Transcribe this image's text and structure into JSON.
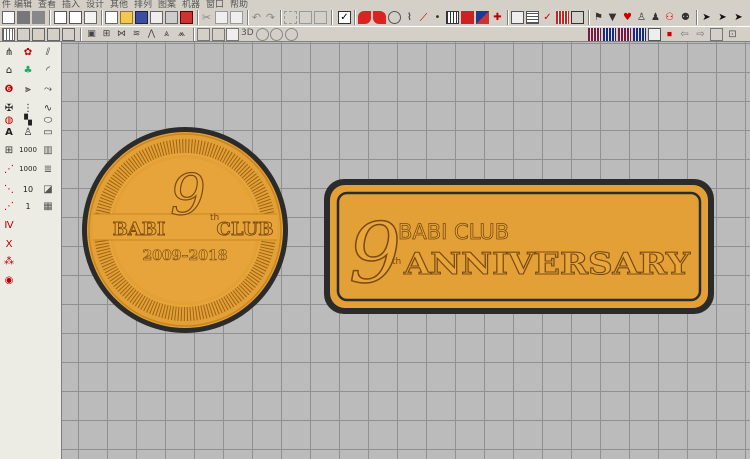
{
  "menu": [
    "件",
    "编辑",
    "查看",
    "插入",
    "设计",
    "其他",
    "排列",
    "图案",
    "机器",
    "窗口",
    "帮助"
  ],
  "toolbar": {
    "zoom_label": "3D"
  },
  "left_tools": [
    {
      "name": "tool-a",
      "label": "A"
    },
    {
      "name": "tool-1000-a",
      "label": "1000"
    },
    {
      "name": "tool-1000-b",
      "label": "1000"
    },
    {
      "name": "tool-10",
      "label": "10"
    },
    {
      "name": "tool-1",
      "label": "1"
    }
  ],
  "patch_round": {
    "top_line": "BABI",
    "club": "CLUB",
    "years": "2009–2018",
    "numeral": "9",
    "suffix": "th"
  },
  "patch_rect": {
    "numeral": "9",
    "suffix": "th",
    "top_line": "BABI CLUB",
    "main_line": "ANNIVERSARY"
  },
  "colors": {
    "thread_gold": "#e9a73b",
    "thread_dark": "#2b2b2b",
    "canvas": "#bbbbbb",
    "grid": "#909090"
  }
}
